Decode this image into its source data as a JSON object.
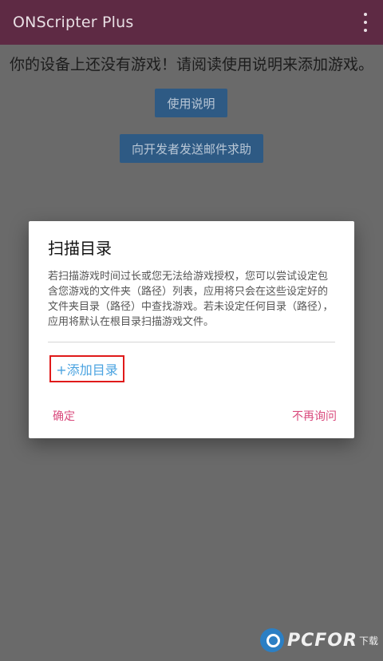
{
  "appbar": {
    "title": "ONScripter Plus",
    "overflow_icon": "more-vert-icon"
  },
  "main": {
    "empty_message": "你的设备上还没有游戏！请阅读使用说明来添加游戏。",
    "manual_button": "使用说明",
    "email_button": "向开发者发送邮件求助"
  },
  "dialog": {
    "title": "扫描目录",
    "body": "若扫描游戏时间过长或您无法给游戏授权，您可以尝试设定包含您游戏的文件夹（路径）列表，应用将只会在这些设定好的文件夹目录（路径）中查找游戏。若未设定任何目录（路径），应用将默认在根目录扫描游戏文件。",
    "add_directory": "+添加目录",
    "confirm": "确定",
    "never_ask": "不再询问"
  },
  "watermark": {
    "brand": "PCFOR",
    "sub": "下载"
  },
  "colors": {
    "appbar": "#5e2a44",
    "accent_pink": "#d9497c",
    "link_blue": "#4aa3e0",
    "highlight_red": "#e01a1a"
  }
}
